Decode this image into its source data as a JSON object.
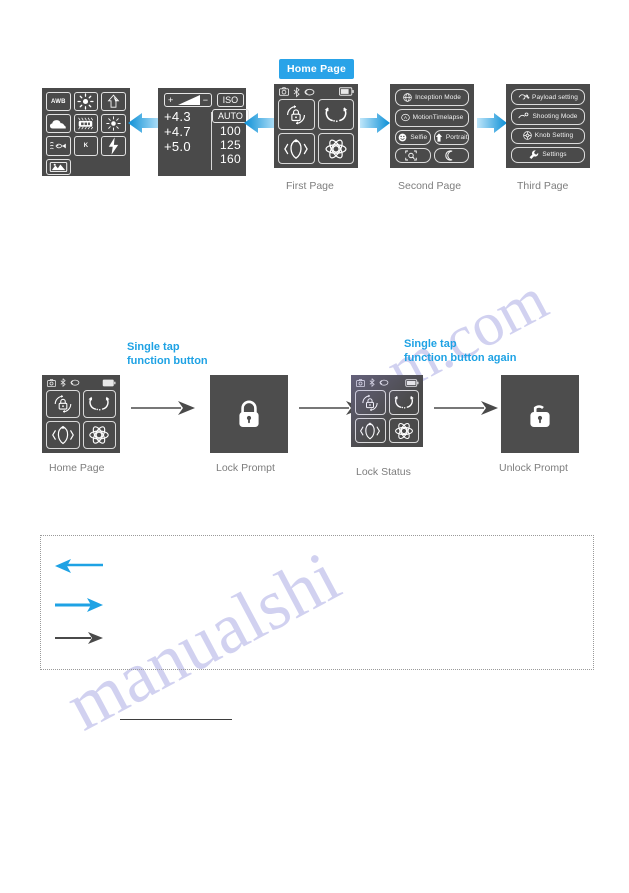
{
  "watermark": {
    "line1": "m.com",
    "line2": "manualshi"
  },
  "flow_top": {
    "badge_label": "Home Page",
    "panels": [
      {
        "id": "white-balance",
        "caption": "",
        "icons": [
          {
            "name": "awb-icon",
            "label": "AWB"
          },
          {
            "name": "daylight-sun-icon",
            "label": ""
          },
          {
            "name": "shade-icon",
            "label": ""
          },
          {
            "name": "cloudy-icon",
            "label": ""
          },
          {
            "name": "fluorescent-icon",
            "label": ""
          },
          {
            "name": "incandescent-icon",
            "label": ""
          },
          {
            "name": "underwater-icon",
            "label": ""
          },
          {
            "name": "kelvin-icon",
            "label": "K"
          },
          {
            "name": "flash-icon",
            "label": ""
          },
          {
            "name": "custom-wb-icon",
            "label": ""
          }
        ]
      },
      {
        "id": "exposure-iso",
        "caption": "",
        "ev_bar": {
          "plus": "+",
          "minus": "−"
        },
        "ev_values": [
          "+4.3",
          "+4.7",
          "+5.0"
        ],
        "iso_title": "ISO",
        "iso_auto": "AUTO",
        "iso_values": [
          "100",
          "125",
          "160"
        ]
      },
      {
        "id": "first-page",
        "caption": "First Page",
        "statusbar": [
          "camera-icon",
          "bluetooth-icon",
          "sync-icon",
          "battery-icon"
        ],
        "tiles": [
          "pan-follow-lock-icon",
          "follow-mode-icon",
          "fpv-mode-icon",
          "vortex-mode-icon"
        ]
      },
      {
        "id": "second-page",
        "caption": "Second Page",
        "buttons": [
          {
            "label": "Inception Mode",
            "icon": "inception-icon"
          },
          {
            "label": "MotionTimelapse",
            "icon": "motion-timelapse-icon"
          },
          {
            "label": "Selfie",
            "icon": "selfie-icon"
          },
          {
            "label": "Portrait",
            "icon": "portrait-icon"
          },
          {
            "label": "",
            "icon": "focus-zoom-icon"
          },
          {
            "label": "",
            "icon": "moon-night-icon"
          }
        ]
      },
      {
        "id": "third-page",
        "caption": "Third Page",
        "buttons": [
          {
            "label": "Payload setting",
            "icon": "payload-icon"
          },
          {
            "label": "Shooting Mode",
            "icon": "shooting-mode-icon"
          },
          {
            "label": "Knob Setting",
            "icon": "knob-icon"
          },
          {
            "label": "Settings",
            "icon": "wrench-icon"
          }
        ]
      }
    ]
  },
  "flow_lock": {
    "callout_1": {
      "line1": "Single tap",
      "line2": "function button"
    },
    "callout_2": {
      "line1": "Single tap",
      "line2": "function button again"
    },
    "steps": [
      {
        "id": "home-page",
        "caption": "Home Page"
      },
      {
        "id": "lock-prompt",
        "caption": "Lock Prompt",
        "icon": "padlock-closed-icon"
      },
      {
        "id": "lock-status",
        "caption": "Lock Status"
      },
      {
        "id": "unlock-prompt",
        "caption": "Unlock Prompt",
        "icon": "padlock-open-icon"
      }
    ]
  },
  "legend": {
    "items": [
      {
        "name": "blue-arrow-left",
        "direction": "left",
        "color": "#1ea2e4"
      },
      {
        "name": "blue-arrow-right",
        "direction": "right",
        "color": "#1ea2e4"
      },
      {
        "name": "gray-arrow-right",
        "direction": "right",
        "color": "#4a4a4a"
      }
    ]
  },
  "colors": {
    "accent_blue": "#1ea2e4",
    "badge_blue": "#29a3e8",
    "screen_gray": "#4a4a4a",
    "caption_gray": "#7d7d7d",
    "arrow_gray": "#4a4a4a"
  }
}
